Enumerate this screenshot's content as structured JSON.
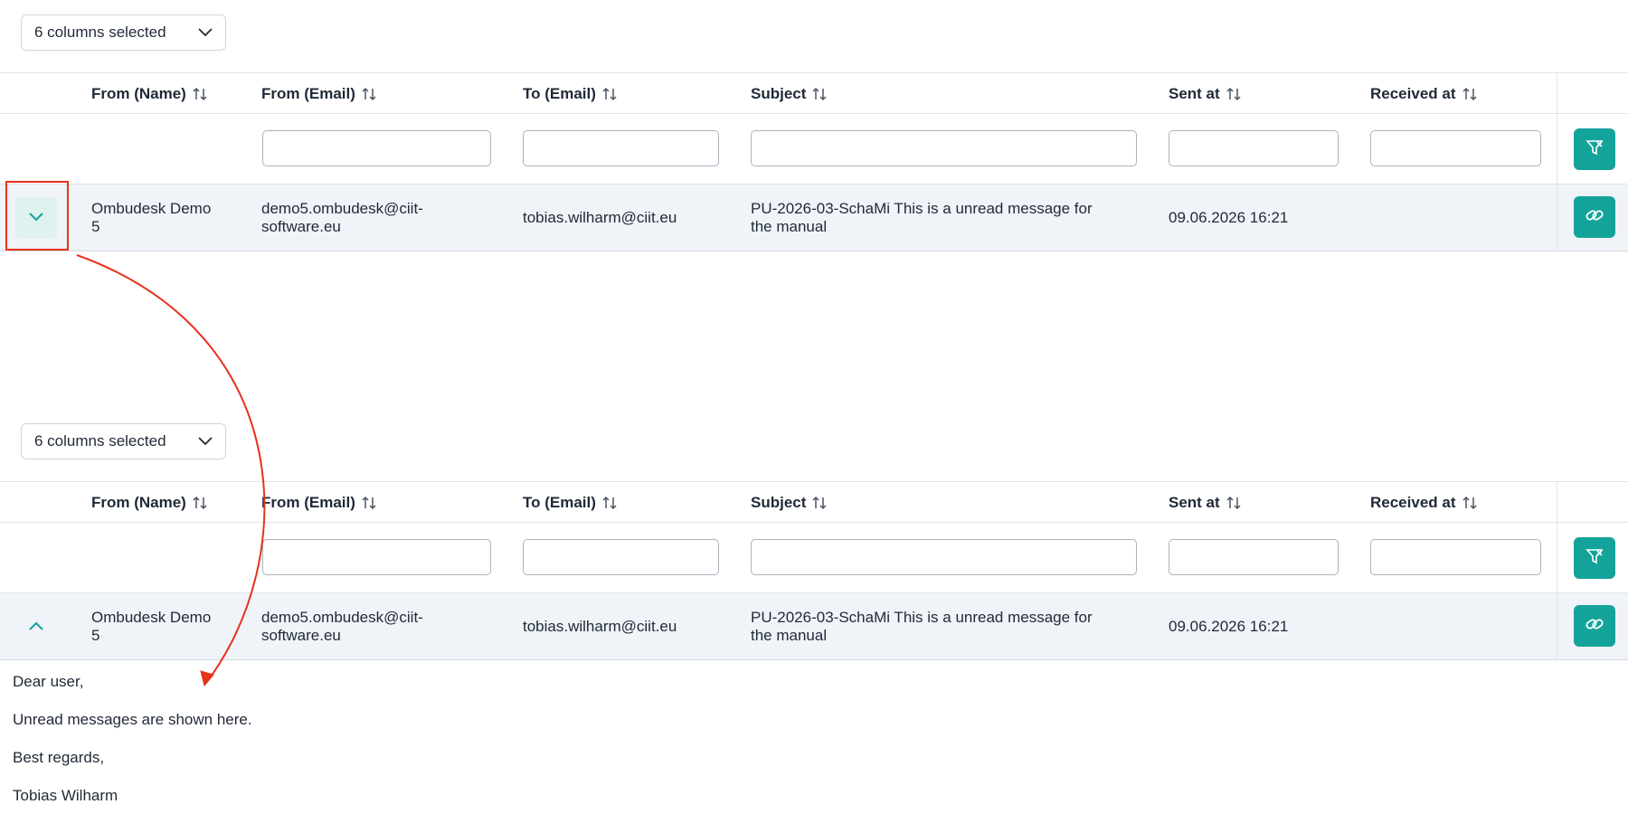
{
  "column_selector": {
    "label": "6 columns selected"
  },
  "columns": [
    "From (Name)",
    "From (Email)",
    "To (Email)",
    "Subject",
    "Sent at",
    "Received at"
  ],
  "row": {
    "from_name_line1": "Ombudesk Demo",
    "from_name_line2": "5",
    "from_email_line1": "demo5.ombudesk@ciit-",
    "from_email_line2": "software.eu",
    "to_email": "tobias.wilharm@ciit.eu",
    "subject_line1": "PU-2026-03-SchaMi This is a unread message for",
    "subject_line2": "the manual",
    "sent_at": "09.06.2026 16:21",
    "received_at": ""
  },
  "message": {
    "greeting": "Dear user,",
    "body": "Unread messages are shown here.",
    "closing": "Best regards,",
    "signature": "Tobias Wilharm"
  },
  "colors": {
    "accent": "#14a39a",
    "annotation": "#e8321c",
    "row_bg": "#f0f3f8"
  },
  "icons": [
    "chevron-down-icon",
    "sort-icon",
    "clear-filter-icon",
    "link-icon",
    "chevron-up-icon"
  ]
}
